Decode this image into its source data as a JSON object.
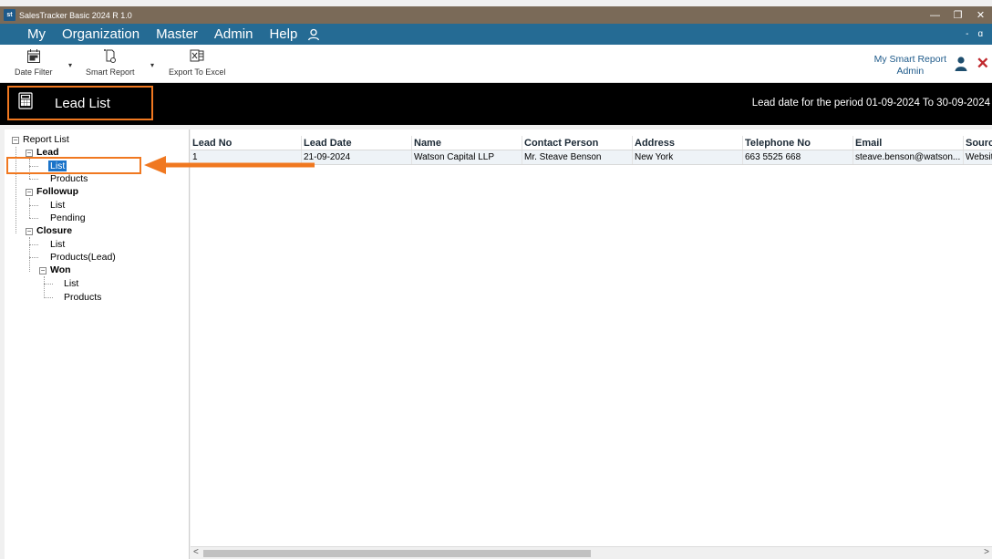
{
  "window": {
    "logo": "st",
    "title": "SalesTracker Basic 2024 R 1.0",
    "controls": {
      "minimize": "—",
      "restore": "❐",
      "close": "✕"
    }
  },
  "menu": {
    "items": [
      "My",
      "Organization",
      "Master",
      "Admin",
      "Help"
    ],
    "mdi_minimize": "-",
    "mdi_restore": "ɑ"
  },
  "toolbar": {
    "date_filter": "Date Filter",
    "smart_report": "Smart Report",
    "export_excel": "Export To Excel",
    "smart_link_line1": "My Smart Report",
    "smart_link_line2": "Admin",
    "close_glyph": "✕"
  },
  "header": {
    "title": "Lead List",
    "period": "Lead date for the period 01-09-2024 To 30-09-2024"
  },
  "tree": {
    "root": "Report List",
    "lead": "Lead",
    "lead_list": "List",
    "lead_products": "Products",
    "followup": "Followup",
    "followup_list": "List",
    "followup_pending": "Pending",
    "closure": "Closure",
    "closure_list": "List",
    "closure_products": "Products(Lead)",
    "won": "Won",
    "won_list": "List",
    "won_products": "Products",
    "expander_glyph": "−"
  },
  "table": {
    "headers": [
      "Lead No",
      "Lead Date",
      "Name",
      "Contact Person",
      "Address",
      "Telephone No",
      "Email",
      "Source"
    ],
    "rows": [
      [
        "1",
        "21-09-2024",
        "Watson Capital LLP",
        "Mr. Steave Benson",
        "New York",
        "663 5525 668",
        "steave.benson@watson...",
        "Website"
      ]
    ]
  },
  "scroll": {
    "left": "<",
    "right": ">"
  },
  "colors": {
    "accent_orange": "#f07820",
    "menu_blue": "#256b94",
    "selection_blue": "#1a73c9"
  }
}
